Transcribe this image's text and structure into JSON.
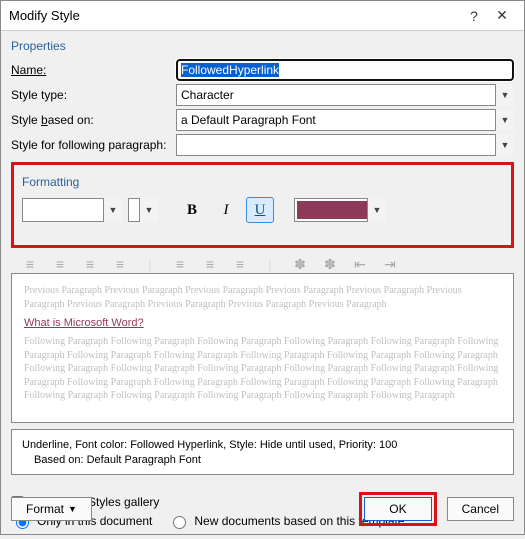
{
  "titlebar": {
    "title": "Modify Style",
    "help": "?",
    "close": "✕"
  },
  "properties": {
    "heading": "Properties",
    "name_label": "Name:",
    "name_value": "FollowedHyperlink",
    "type_label": "Style type:",
    "type_value": "Character",
    "based_label": "Style based on:",
    "based_value": "a Default Paragraph Font",
    "following_label": "Style for following paragraph:",
    "following_value": ""
  },
  "formatting": {
    "heading": "Formatting",
    "color": "#8d3a59"
  },
  "preview": {
    "prev_text": "Previous Paragraph Previous Paragraph Previous Paragraph Previous Paragraph Previous Paragraph Previous Paragraph Previous Paragraph Previous Paragraph Previous Paragraph Previous Paragraph",
    "sample": "What is Microsoft Word?",
    "next_text": "Following Paragraph Following Paragraph Following Paragraph Following Paragraph Following Paragraph Following Paragraph Following Paragraph Following Paragraph Following Paragraph Following Paragraph Following Paragraph Following Paragraph Following Paragraph Following Paragraph Following Paragraph Following Paragraph Following Paragraph Following Paragraph Following Paragraph Following Paragraph Following Paragraph Following Paragraph Following Paragraph Following Paragraph Following Paragraph Following Paragraph Following Paragraph"
  },
  "description": {
    "line1": "Underline, Font color: Followed Hyperlink, Style: Hide until used, Priority: 100",
    "line2": "Based on: Default Paragraph Font"
  },
  "options": {
    "add_gallery": "Add to the Styles gallery",
    "only_doc": "Only in this document",
    "new_docs": "New documents based on this template"
  },
  "buttons": {
    "format": "Format",
    "ok": "OK",
    "cancel": "Cancel"
  }
}
